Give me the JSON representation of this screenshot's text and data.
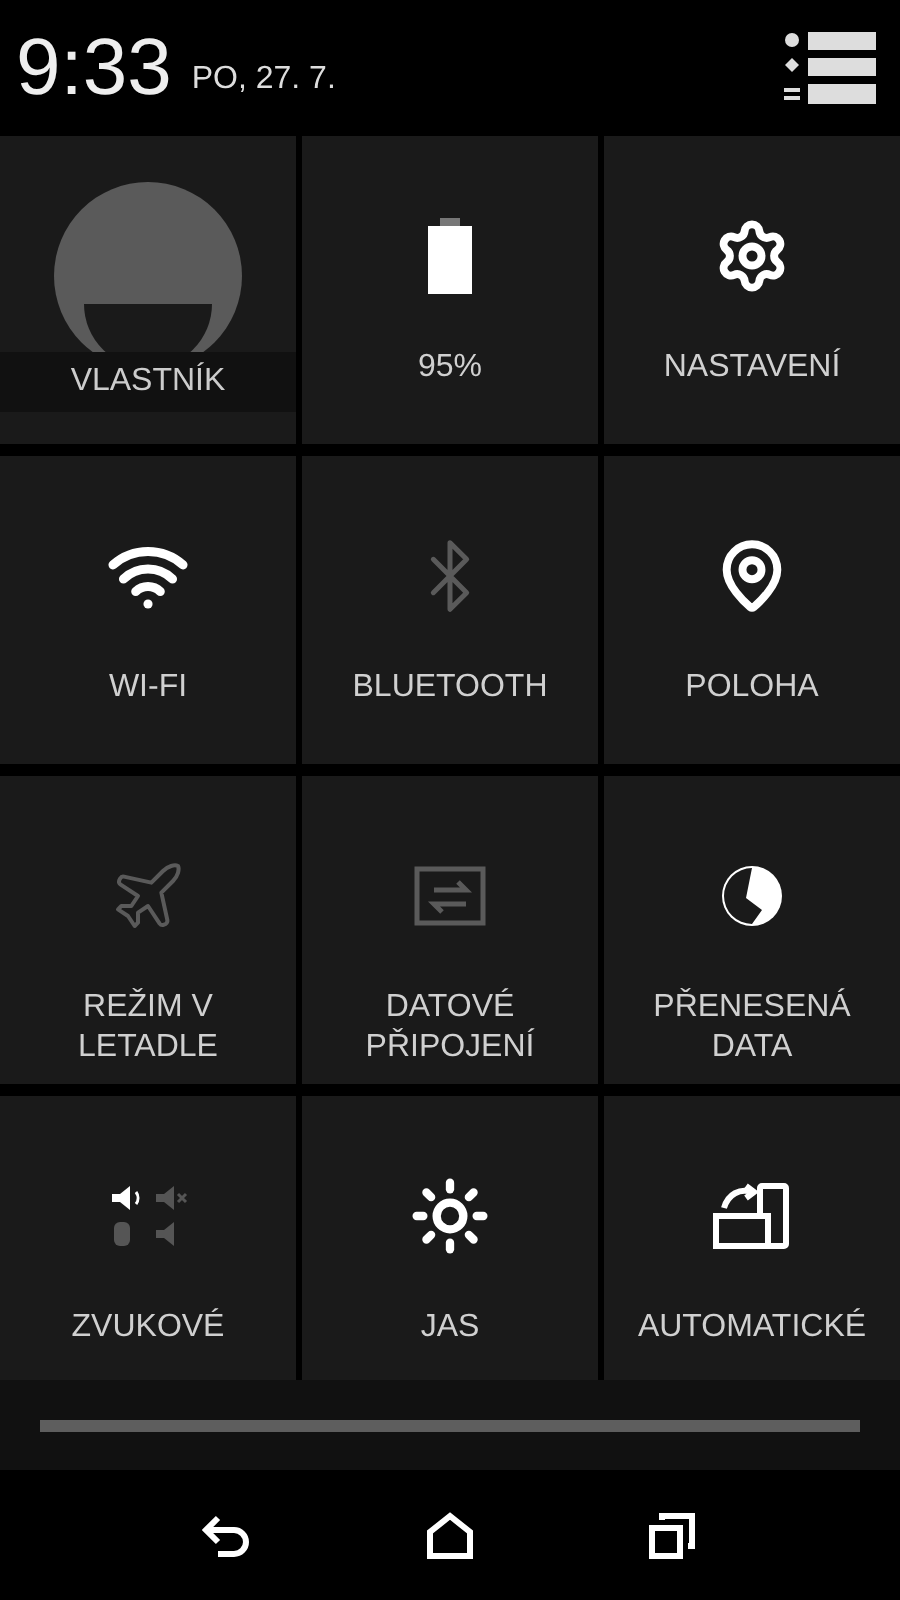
{
  "status": {
    "time": "9:33",
    "date": "PO, 27. 7."
  },
  "tiles": [
    {
      "kind": "profile",
      "label": "VLASTNÍK",
      "on": true
    },
    {
      "kind": "toggle",
      "label": "95%",
      "on": true
    },
    {
      "kind": "toggle",
      "label": "NASTAVENÍ",
      "on": true
    },
    {
      "kind": "toggle",
      "label": "WI-FI",
      "on": true
    },
    {
      "kind": "toggle",
      "label": "BLUETOOTH",
      "on": false
    },
    {
      "kind": "toggle",
      "label": "POLOHA",
      "on": true
    },
    {
      "kind": "toggle",
      "label": "REŽIM V LETADLE",
      "on": false
    },
    {
      "kind": "toggle",
      "label": "DATOVÉ PŘIPOJENÍ",
      "on": false
    },
    {
      "kind": "toggle",
      "label": "PŘENESENÁ DATA",
      "on": true
    },
    {
      "kind": "toggle",
      "label": "ZVUKOVÉ",
      "on": true
    },
    {
      "kind": "toggle",
      "label": "JAS",
      "on": true
    },
    {
      "kind": "toggle",
      "label": "AUTOMATICKÉ",
      "on": true
    }
  ]
}
